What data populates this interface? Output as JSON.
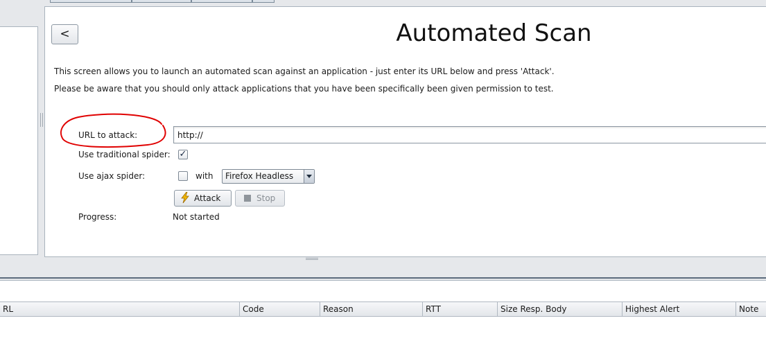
{
  "panel": {
    "back_label": "<",
    "title": "Automated Scan",
    "description_line1": "This screen allows you to launch an automated scan against  an application - just enter its URL below and press 'Attack'.",
    "description_line2": "Please be aware that you should only attack applications that you have been specifically been given permission to test."
  },
  "form": {
    "url_label": "URL to attack:",
    "url_value": "http://",
    "traditional_spider_label": "Use traditional spider:",
    "traditional_spider_checked": true,
    "ajax_spider_label": "Use ajax spider:",
    "ajax_spider_checked": false,
    "with_label": "with",
    "browser_selected": "Firefox Headless",
    "attack_label": "Attack",
    "stop_label": "Stop",
    "progress_label": "Progress:",
    "progress_value": "Not started"
  },
  "table": {
    "columns": [
      "RL",
      "Code",
      "Reason",
      "RTT",
      "Size Resp. Body",
      "Highest Alert",
      "Note"
    ]
  },
  "colors": {
    "annotation_circle": "#e00000",
    "attack_icon": "#f2b705"
  },
  "icons": {
    "attack": "lightning-bolt-icon",
    "stop": "stop-square-icon",
    "dropdown": "chevron-down-icon"
  }
}
